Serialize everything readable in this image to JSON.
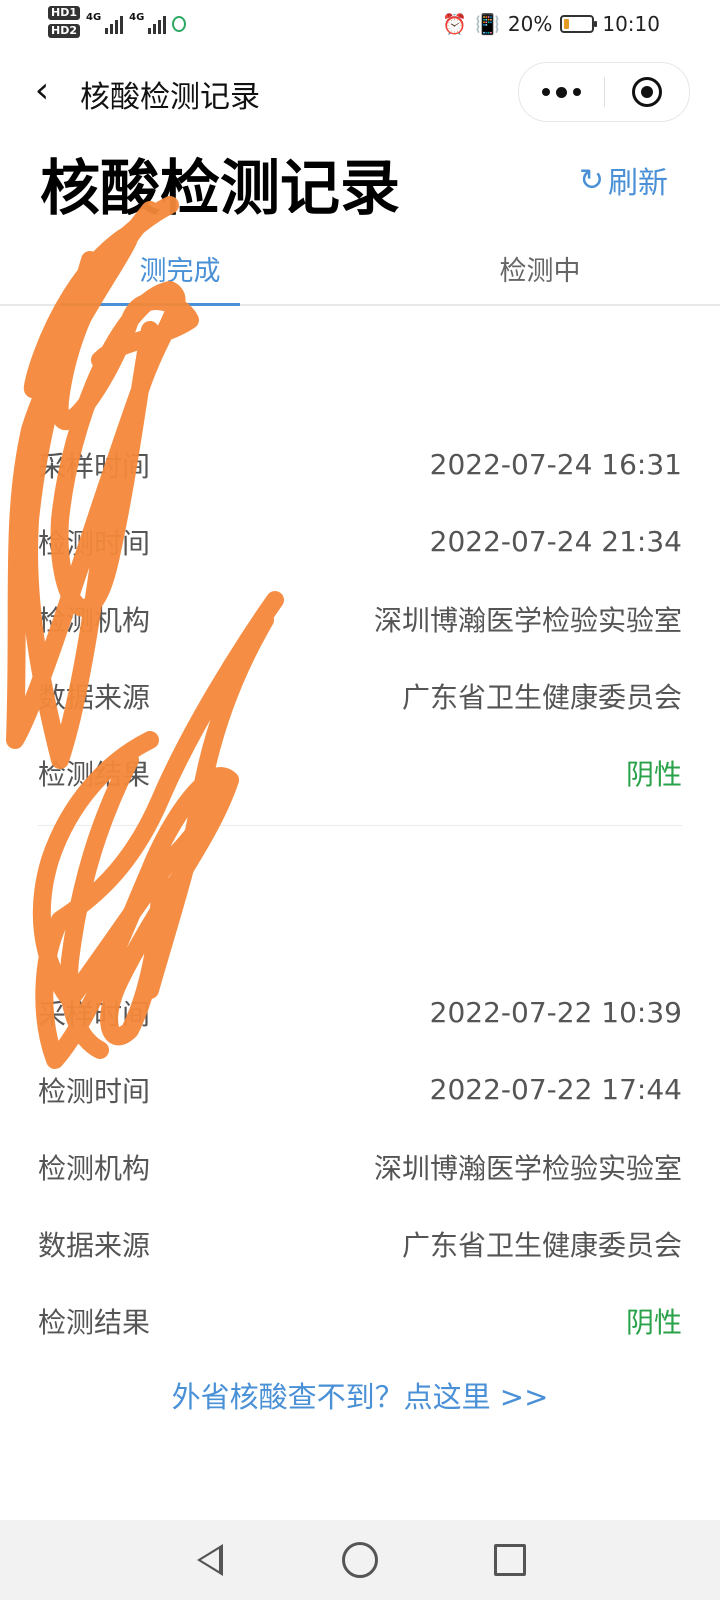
{
  "status_bar": {
    "hd1": "HD1",
    "hd2": "HD2",
    "net1": "4G",
    "net2": "4G",
    "battery_pct": "20%",
    "battery_level": 0.2,
    "time": "10:10",
    "icons": [
      "alarm-icon",
      "vibrate-icon",
      "battery-icon"
    ]
  },
  "nav": {
    "title": "核酸检测记录",
    "back_icon": "chevron-left-icon",
    "more_icon": "more-dots-icon",
    "close_icon": "target-close-icon"
  },
  "page": {
    "title": "核酸检测记录",
    "refresh_label": "刷新",
    "refresh_icon": "↻"
  },
  "tabs": [
    {
      "label": "测完成",
      "active": true
    },
    {
      "label": "检测中",
      "active": false
    }
  ],
  "records": [
    {
      "name": "",
      "rows": [
        {
          "label": "采样时间",
          "value": "2022-07-24 16:31"
        },
        {
          "label": "检测时间",
          "value": "2022-07-24 21:34"
        },
        {
          "label": "检测机构",
          "value": "深圳博瀚医学检验实验室"
        },
        {
          "label": "数据来源",
          "value": "广东省卫生健康委员会"
        },
        {
          "label": "检测结果",
          "value": "阴性"
        }
      ]
    },
    {
      "name": "",
      "rows": [
        {
          "label": "采样时间",
          "value": "2022-07-22 10:39"
        },
        {
          "label": "检测时间",
          "value": "2022-07-22 17:44"
        },
        {
          "label": "检测机构",
          "value": "深圳博瀚医学检验实验室"
        },
        {
          "label": "数据来源",
          "value": "广东省卫生健康委员会"
        },
        {
          "label": "检测结果",
          "value": "阴性"
        }
      ]
    }
  ],
  "help_link": "外省核酸查不到？点这里 >>",
  "colors": {
    "accent": "#4a90d6",
    "negative": "#2aa24a",
    "scribble": "#f5893a"
  },
  "system_nav": [
    "back-triangle-icon",
    "home-circle-icon",
    "recents-square-icon"
  ]
}
